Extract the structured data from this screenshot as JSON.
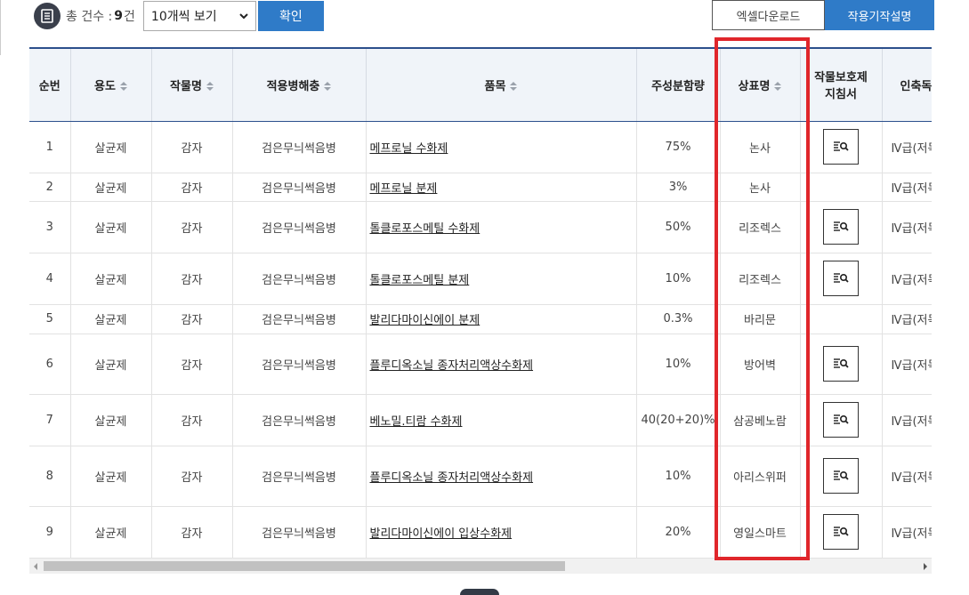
{
  "toolbar": {
    "count_label": "총 건수 :",
    "count_value": "9",
    "count_suffix": "건",
    "page_size": "10개씩 보기",
    "confirm_label": "확인",
    "excel_label": "엑셀다운로드",
    "guide_label": "작용기작설명"
  },
  "table": {
    "headers": {
      "no": "순번",
      "use": "용도",
      "crop": "작물명",
      "disease": "적용병해충",
      "product": "품목",
      "content": "주성분함량",
      "brand": "상표명",
      "guide": "작물보호제 지침서",
      "toxicity": "인축독성"
    },
    "rows": [
      {
        "no": "1",
        "use": "살균제",
        "crop": "감자",
        "disease": "검은무늬썩음병",
        "product": "메프로닐 수화제",
        "content": "75%",
        "brand": "논사",
        "guide": true,
        "toxicity": "Ⅳ급(저독성)"
      },
      {
        "no": "2",
        "use": "살균제",
        "crop": "감자",
        "disease": "검은무늬썩음병",
        "product": "메프로닐 분제",
        "content": "3%",
        "brand": "논사",
        "guide": false,
        "toxicity": "Ⅳ급(저독성)"
      },
      {
        "no": "3",
        "use": "살균제",
        "crop": "감자",
        "disease": "검은무늬썩음병",
        "product": "톨클로포스메틸 수화제",
        "content": "50%",
        "brand": "리조렉스",
        "guide": true,
        "toxicity": "Ⅳ급(저독성)"
      },
      {
        "no": "4",
        "use": "살균제",
        "crop": "감자",
        "disease": "검은무늬썩음병",
        "product": "톨클로포스메틸 분제",
        "content": "10%",
        "brand": "리조렉스",
        "guide": true,
        "toxicity": "Ⅳ급(저독성)"
      },
      {
        "no": "5",
        "use": "살균제",
        "crop": "감자",
        "disease": "검은무늬썩음병",
        "product": "발리다마이신에이 분제",
        "content": "0.3%",
        "brand": "바리문",
        "guide": false,
        "toxicity": "Ⅳ급(저독성)"
      },
      {
        "no": "6",
        "use": "살균제",
        "crop": "감자",
        "disease": "검은무늬썩음병",
        "product": "플루디옥소닐 종자처리액상수화제",
        "content": "10%",
        "brand": "방어벽",
        "guide": true,
        "toxicity": "Ⅳ급(저독성)"
      },
      {
        "no": "7",
        "use": "살균제",
        "crop": "감자",
        "disease": "검은무늬썩음병",
        "product": "베노밀.티람 수화제",
        "content": "40(20+20)%",
        "brand": "삼공베노람",
        "guide": true,
        "toxicity": "Ⅳ급(저독성)"
      },
      {
        "no": "8",
        "use": "살균제",
        "crop": "감자",
        "disease": "검은무늬썩음병",
        "product": "플루디옥소닐 종자처리액상수화제",
        "content": "10%",
        "brand": "아리스위퍼",
        "guide": true,
        "toxicity": "Ⅳ급(저독성)"
      },
      {
        "no": "9",
        "use": "살균제",
        "crop": "감자",
        "disease": "검은무늬썩음병",
        "product": "발리다마이신에이 입상수화제",
        "content": "20%",
        "brand": "영일스마트",
        "guide": true,
        "toxicity": "Ⅳ급(저독성)"
      }
    ]
  },
  "colors": {
    "accent": "#2f7bc8",
    "header_border": "#2c4f8c",
    "header_bg": "#f0f4f9",
    "highlight": "#e0262b"
  }
}
